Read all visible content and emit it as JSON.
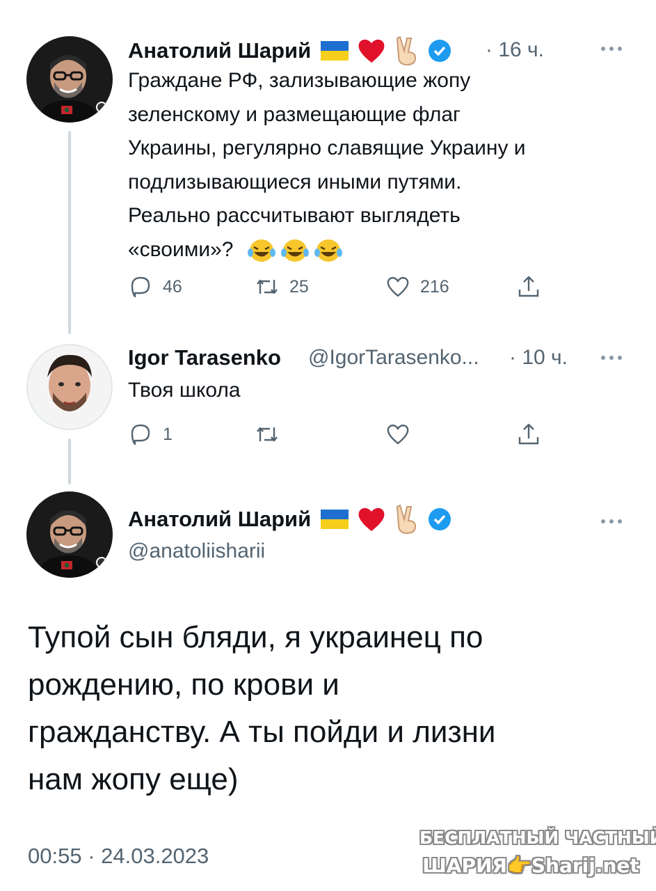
{
  "tweets": [
    {
      "author": "Анатолий Шарий",
      "flair": [
        "ukraine-flag-icon",
        "heart-icon",
        "victory-hand-icon",
        "verified-badge-icon"
      ],
      "time": "· 16 ч.",
      "lines": [
        "Граждане РФ, зализывающие жопу",
        "зеленскому и размещающие флаг",
        "Украины, регулярно славящие Украину и",
        "подлизывающиеся иными путями.",
        "Реально рассчитывают выглядеть",
        "«своими»?"
      ],
      "reply_count": "46",
      "retweet_count": "25",
      "like_count": "216"
    },
    {
      "author": "Igor Tarasenko",
      "handle": "@IgorTarasenko...",
      "time": "· 10 ч.",
      "text": "Твоя школа",
      "reply_count": "1",
      "retweet_count": "",
      "like_count": ""
    }
  ],
  "main_tweet": {
    "author": "Анатолий Шарий",
    "handle": "@anatoliisharii",
    "text_lines": [
      "Тупой сын бляди, я украинец по",
      "рождению, по крови и",
      "гражданству. А ты пойди и лизни",
      "нам жопу еще)"
    ],
    "timestamp": "00:55 · 24.03.2023"
  },
  "watermark": {
    "line1": "БЕСПЛАТНЫЙ ЧАСТНЫЙ",
    "line2": "ШАРИЯ👉Sharij.net"
  },
  "colors": {
    "text": "#0f1419",
    "muted": "#536471",
    "verified": "#1d9bf0",
    "thread_line": "#cfd9de"
  }
}
